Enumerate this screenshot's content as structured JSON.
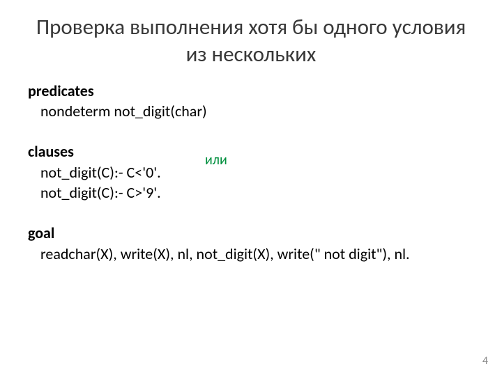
{
  "title": "Проверка выполнения хотя бы одного условия из нескольких",
  "predicates": {
    "head": "predicates",
    "line1": "nondeterm not_digit(char)"
  },
  "clauses": {
    "head": "clauses",
    "line1": "not_digit(C):- C<'0'.",
    "line2": "not_digit(C):- C>'9'.",
    "annotation": "или"
  },
  "goal": {
    "head": "goal",
    "line1": "readchar(X), write(X), nl, not_digit(X), write(\" not digit\"), nl."
  },
  "page_number": "4"
}
